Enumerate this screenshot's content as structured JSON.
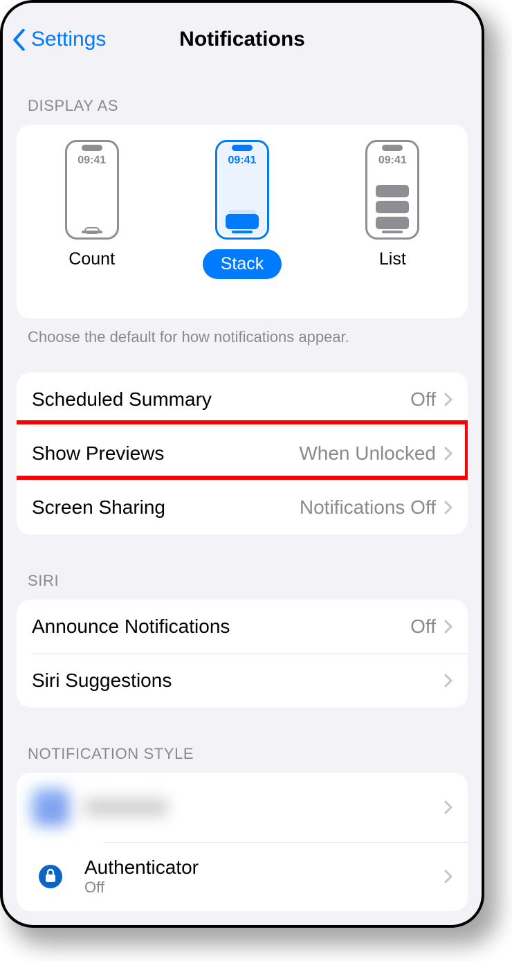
{
  "nav": {
    "back_label": "Settings",
    "title": "Notifications"
  },
  "display_as": {
    "header": "DISPLAY AS",
    "time": "09:41",
    "options": [
      {
        "label": "Count"
      },
      {
        "label": "Stack"
      },
      {
        "label": "List"
      }
    ],
    "footer": "Choose the default for how notifications appear."
  },
  "settings_rows": [
    {
      "label": "Scheduled Summary",
      "value": "Off"
    },
    {
      "label": "Show Previews",
      "value": "When Unlocked"
    },
    {
      "label": "Screen Sharing",
      "value": "Notifications Off"
    }
  ],
  "siri": {
    "header": "SIRI",
    "rows": [
      {
        "label": "Announce Notifications",
        "value": "Off"
      },
      {
        "label": "Siri Suggestions",
        "value": ""
      }
    ]
  },
  "notification_style": {
    "header": "NOTIFICATION STYLE",
    "apps": [
      {
        "name": "",
        "sub": ""
      },
      {
        "name": "Authenticator",
        "sub": "Off"
      }
    ]
  }
}
